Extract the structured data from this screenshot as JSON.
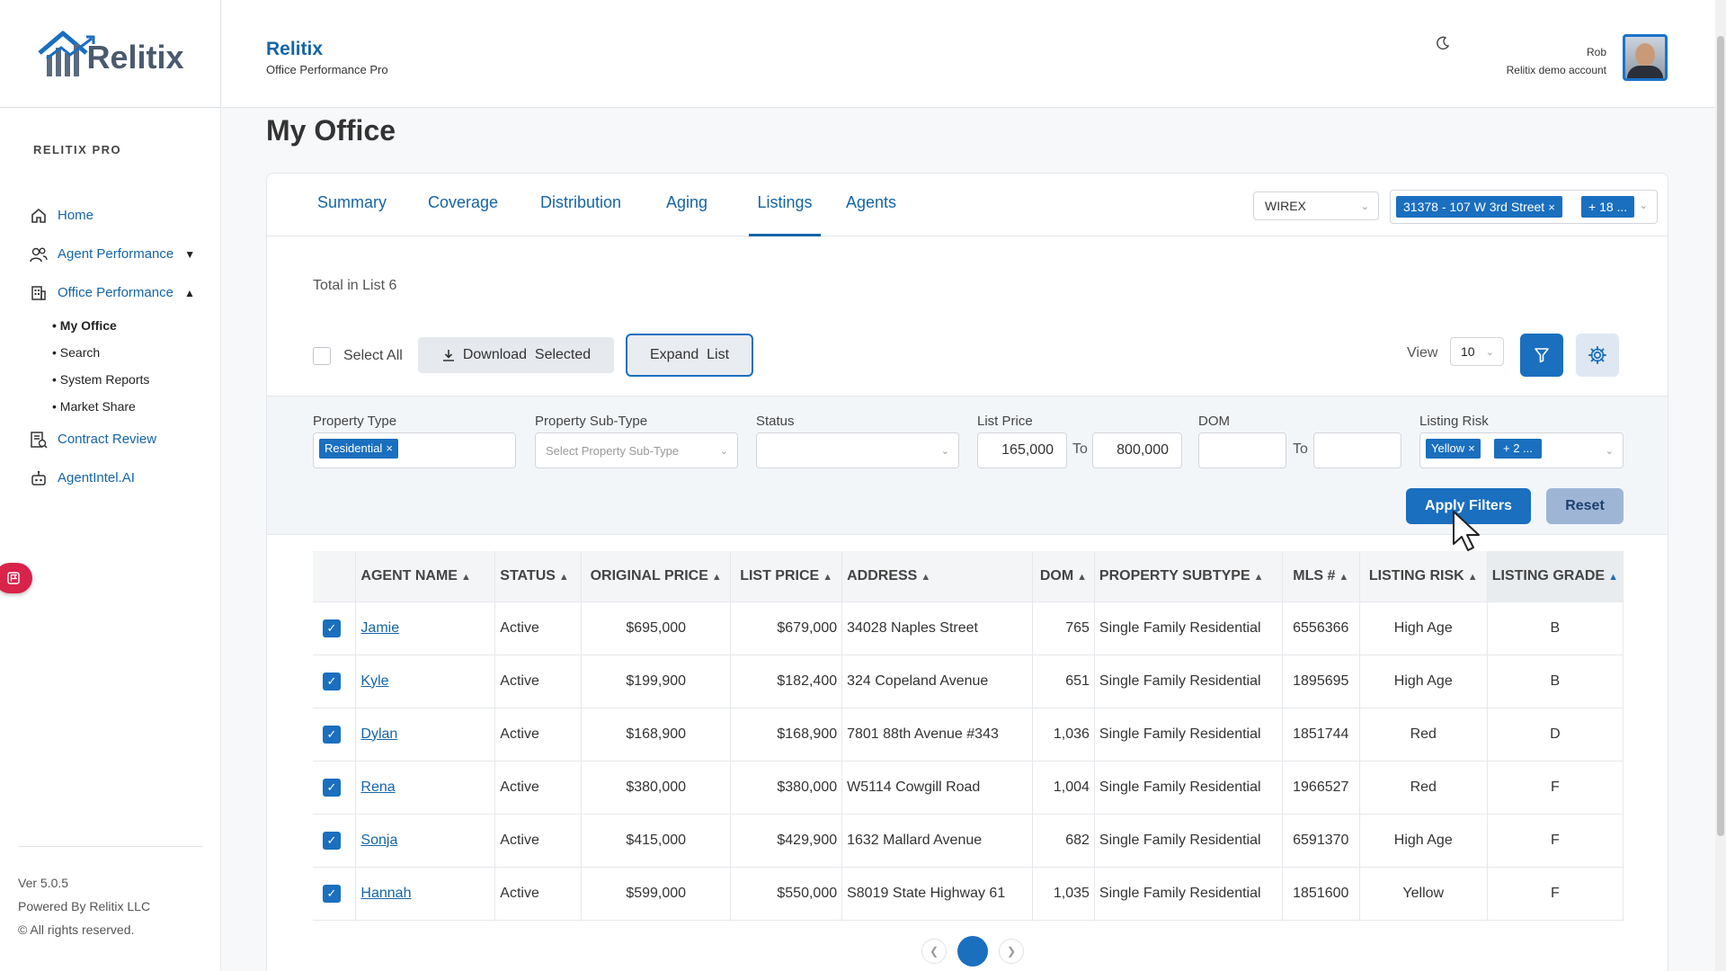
{
  "sidebar": {
    "logo_text": "Relitix",
    "section_label": "RELITIX PRO",
    "items": [
      {
        "label": "Home",
        "icon": "home-icon"
      },
      {
        "label": "Agent Performance",
        "icon": "users-icon",
        "caret": "▼"
      },
      {
        "label": "Office Performance",
        "icon": "building-icon",
        "caret": "▲"
      },
      {
        "label": "Contract Review",
        "icon": "contract-icon"
      },
      {
        "label": "AgentIntel.AI",
        "icon": "robot-icon"
      }
    ],
    "subitems": [
      "• My Office",
      "• Search",
      "• System Reports",
      "• Market Share"
    ],
    "version": "Ver 5.0.5",
    "powered": "Powered By Relitix LLC",
    "rights": "© All rights reserved."
  },
  "header": {
    "brand": "Relitix",
    "subtitle": "Office Performance Pro",
    "user_name": "Rob",
    "user_account": "Relitix demo account"
  },
  "page": {
    "title": "My Office"
  },
  "tabs": [
    "Summary",
    "Coverage",
    "Distribution",
    "Aging",
    "Listings",
    "Agents"
  ],
  "active_tab": "Listings",
  "controls": {
    "mls_select": "WIREX",
    "office_chip": "31378 - 107 W 3rd Street",
    "office_more": "+ 18 ...",
    "total": "Total in List 6",
    "select_all": "Select All",
    "download": "Download  Selected",
    "expand": "Expand  List",
    "view_label": "View",
    "view_value": "10"
  },
  "filters": {
    "property_type_label": "Property Type",
    "property_type_chip": "Residential",
    "subtype_label": "Property Sub-Type",
    "subtype_placeholder": "Select Property Sub-Type",
    "status_label": "Status",
    "list_price_label": "List Price",
    "list_price_from": "165,000",
    "list_price_to": "800,000",
    "to_label": "To",
    "dom_label": "DOM",
    "risk_label": "Listing Risk",
    "risk_chip": "Yellow",
    "risk_more": "+ 2 ...",
    "apply": "Apply Filters",
    "reset": "Reset"
  },
  "table": {
    "columns": [
      "AGENT NAME",
      "STATUS",
      "ORIGINAL PRICE",
      "LIST PRICE",
      "ADDRESS",
      "DOM",
      "PROPERTY SUBTYPE",
      "MLS #",
      "LISTING RISK",
      "LISTING GRADE"
    ],
    "rows": [
      [
        "Jamie ",
        "Active",
        "$695,000",
        "$679,000",
        "34028 Naples Street",
        "765",
        "Single Family Residential",
        "6556366",
        "High Age",
        "B"
      ],
      [
        "Kyle ",
        "Active",
        "$199,900",
        "$182,400",
        "324 Copeland Avenue",
        "651",
        "Single Family Residential",
        "1895695",
        "High Age",
        "B"
      ],
      [
        "Dylan ",
        "Active",
        "$168,900",
        "$168,900",
        "7801 88th Avenue #343",
        "1,036",
        "Single Family Residential",
        "1851744",
        "Red",
        "D"
      ],
      [
        "Rena ",
        "Active",
        "$380,000",
        "$380,000",
        "W5114 Cowgill Road",
        "1,004",
        "Single Family Residential",
        "1966527",
        "Red",
        "F"
      ],
      [
        "Sonja ",
        "Active",
        "$415,000",
        "$429,900",
        "1632 Mallard Avenue",
        "682",
        "Single Family Residential",
        "6591370",
        "High Age",
        "F"
      ],
      [
        "Hannah ",
        "Active",
        "$599,000",
        "$550,000",
        "S8019 State Highway 61",
        "1,035",
        "Single Family Residential",
        "1851600",
        "Yellow",
        "F"
      ]
    ]
  },
  "pagination": {
    "current": "1"
  },
  "colors": {
    "accent": "#1a6fbf",
    "link": "#1565a8"
  }
}
